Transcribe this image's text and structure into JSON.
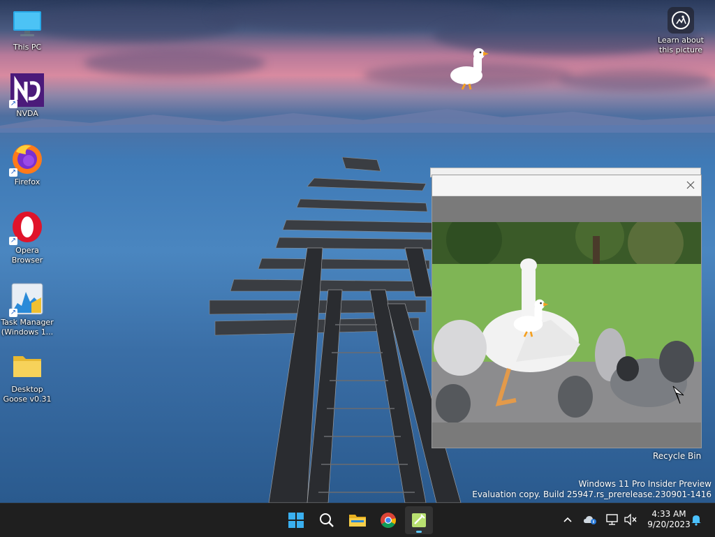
{
  "desktop": {
    "icons": [
      {
        "label": "This PC",
        "icon": "monitor-icon"
      },
      {
        "label": "NVDA",
        "icon": "nvda-icon"
      },
      {
        "label": "Firefox",
        "icon": "firefox-icon"
      },
      {
        "label_lines": [
          "Opera",
          "Browser"
        ],
        "icon": "opera-icon"
      },
      {
        "label_lines": [
          "Task Manager",
          "(Windows 1..."
        ],
        "icon": "task-manager-icon"
      },
      {
        "label_lines": [
          "Desktop",
          "Goose v0.31"
        ],
        "icon": "folder-icon"
      }
    ],
    "learn_about": {
      "lines": [
        "Learn about",
        "this picture"
      ],
      "icon": "camera-icon"
    },
    "recycle_bin": "Recycle Bin",
    "watermark": {
      "line1": "Windows 11 Pro Insider Preview",
      "line2": "Evaluation copy. Build 25947.rs_prerelease.230901-1416"
    }
  },
  "window": {
    "close_icon": "close-icon"
  },
  "taskbar": {
    "apps": [
      {
        "name": "start",
        "icon": "windows-logo-icon"
      },
      {
        "name": "search",
        "icon": "search-icon"
      },
      {
        "name": "file-explorer",
        "icon": "folder-icon"
      },
      {
        "name": "chrome",
        "icon": "chrome-icon"
      },
      {
        "name": "notepad",
        "icon": "notepad-icon",
        "active": true
      }
    ],
    "tray": {
      "icons": [
        "chevron-up-icon",
        "onedrive-icon",
        "network-icon",
        "volume-muted-icon",
        "notification-bell-icon"
      ],
      "time": "4:33 AM",
      "date": "9/20/2023"
    },
    "accent": "#5cc8ff"
  }
}
